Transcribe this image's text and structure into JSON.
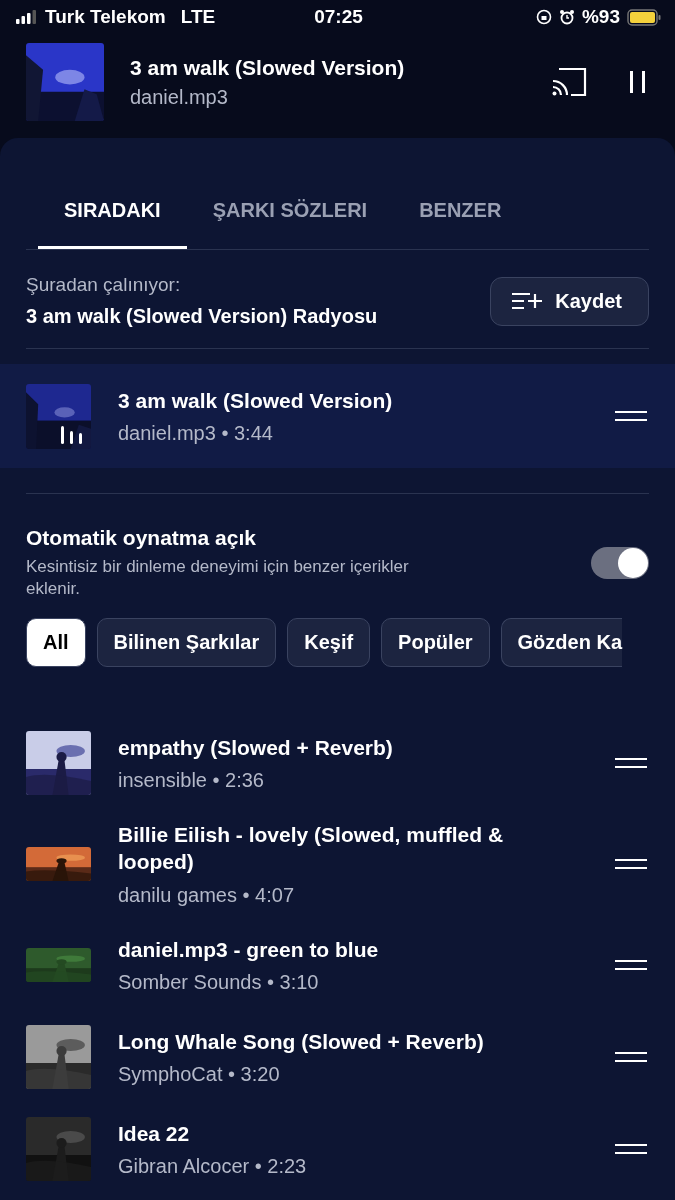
{
  "status_bar": {
    "carrier": "Turk Telekom",
    "network": "LTE",
    "time": "07:25",
    "battery": "%93"
  },
  "now_playing": {
    "title": "3 am walk (Slowed Version)",
    "artist": "daniel.mp3",
    "playing": true
  },
  "tabs": [
    {
      "label": "SIRADAKI",
      "selected": true
    },
    {
      "label": "ŞARKI SÖZLERI",
      "selected": false
    },
    {
      "label": "BENZER",
      "selected": false
    }
  ],
  "source": {
    "label": "Şuradan çalınıyor:",
    "name": "3 am walk (Slowed Version) Radyosu",
    "save_button": "Kaydet"
  },
  "current": {
    "title": "3 am walk (Slowed Version)",
    "info": "daniel.mp3 • 3:44",
    "playing": true
  },
  "autoplay": {
    "title": "Otomatik oynatma açık",
    "description": "Kesintisiz bir dinleme deneyimi için benzer içerikler eklenir.",
    "on": true
  },
  "chips": [
    {
      "label": "All",
      "selected": true
    },
    {
      "label": "Bilinen Şarkılar",
      "selected": false
    },
    {
      "label": "Keşif",
      "selected": false
    },
    {
      "label": "Popüler",
      "selected": false
    },
    {
      "label": "Gözden Ka",
      "selected": false
    }
  ],
  "queue": [
    {
      "title": "empathy (Slowed + Reverb)",
      "info": "insensible • 2:36"
    },
    {
      "title": "Billie Eilish - lovely (Slowed, muffled & looped)",
      "info": "danilu games • 4:07"
    },
    {
      "title": "daniel.mp3 - green to blue",
      "info": "Somber Sounds • 3:10"
    },
    {
      "title": "Long Whale Song (Slowed + Reverb)",
      "info": "SymphoCat • 3:20"
    },
    {
      "title": "Idea 22",
      "info": "Gibran Alcocer • 2:23"
    }
  ]
}
